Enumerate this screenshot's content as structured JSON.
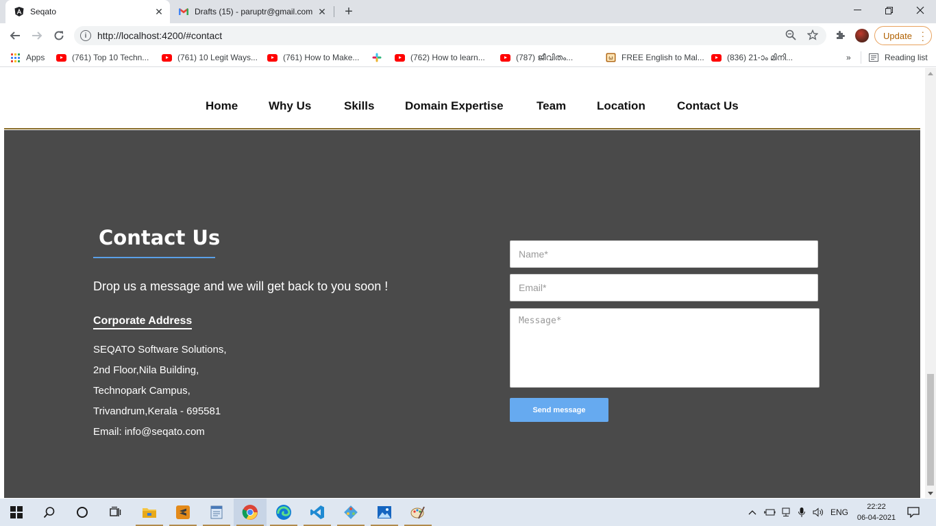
{
  "browser": {
    "tabs": [
      {
        "title": "Seqato",
        "icon": "angular-icon",
        "active": true
      },
      {
        "title": "Drafts (15) - paruptr@gmail.com",
        "icon": "gmail-icon",
        "active": false
      }
    ],
    "url": "http://localhost:4200/#contact",
    "update_label": "Update",
    "bookmarks": [
      {
        "label": "Apps",
        "icon": "apps-grid-icon"
      },
      {
        "label": "(761) Top 10 Techn...",
        "icon": "youtube-icon"
      },
      {
        "label": "(761) 10 Legit Ways...",
        "icon": "youtube-icon"
      },
      {
        "label": "(761) How to Make...",
        "icon": "youtube-icon"
      },
      {
        "label": "",
        "icon": "slack-icon"
      },
      {
        "label": "(762) How to learn...",
        "icon": "youtube-icon"
      },
      {
        "label": "(787) ജീവിതം...",
        "icon": "youtube-icon"
      },
      {
        "label": "FREE English to Mal...",
        "icon": "dictionary-icon"
      },
      {
        "label": "(836) 21-ാം മിനി...",
        "icon": "youtube-icon"
      }
    ],
    "more_bookmarks": "»",
    "reading_list": "Reading list"
  },
  "site_nav": {
    "links": [
      "Home",
      "Why Us",
      "Skills",
      "Domain Expertise",
      "Team",
      "Location",
      "Contact Us"
    ]
  },
  "contact": {
    "title": "Contact Us",
    "tagline": "Drop us a message and we will get back to you soon !",
    "corporate_heading": "Corporate Address",
    "address_lines": [
      "SEQATO Software Solutions,",
      "2nd Floor,Nila Building,",
      "Technopark Campus,",
      "Trivandrum,Kerala - 695581",
      "Email: info@seqato.com"
    ],
    "form": {
      "name_placeholder": "Name*",
      "email_placeholder": "Email*",
      "message_placeholder": "Message*",
      "submit_label": "Send message"
    },
    "colors": {
      "section_bg": "#4a4a4a",
      "accent": "#66aaf0"
    }
  },
  "taskbar": {
    "language": "ENG",
    "time": "22:22",
    "date": "06-04-2021",
    "apps": [
      "start-icon",
      "search-icon",
      "cortana-icon",
      "task-view-icon",
      "file-explorer-icon",
      "sublime-icon",
      "notepad-icon",
      "chrome-icon",
      "edge-icon",
      "vscode-icon",
      "git-icon",
      "photos-icon",
      "paint-icon"
    ]
  }
}
